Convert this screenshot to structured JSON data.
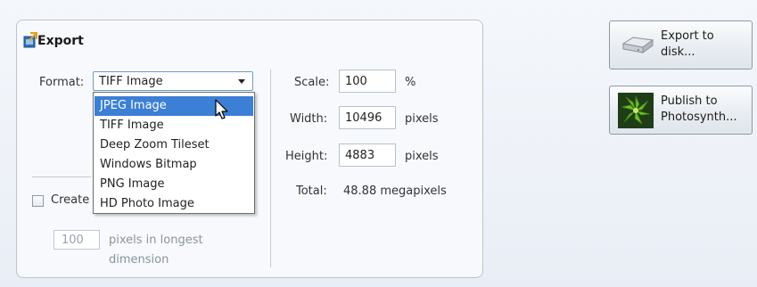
{
  "export_panel": {
    "title": "Export",
    "format_label": "Format:",
    "format_selected": "TIFF Image",
    "format_options": [
      "JPEG Image",
      "TIFF Image",
      "Deep Zoom Tileset",
      "Windows Bitmap",
      "PNG Image",
      "HD Photo Image"
    ],
    "highlighted_option": "JPEG Image",
    "create_checkbox_label": "Create",
    "create_checked": false,
    "longest_dimension_value": "100",
    "longest_dimension_label_1": "pixels in longest",
    "longest_dimension_label_2": "dimension",
    "scale_label": "Scale:",
    "scale_value": "100",
    "scale_unit": "%",
    "width_label": "Width:",
    "width_value": "10496",
    "width_unit": "pixels",
    "height_label": "Height:",
    "height_value": "4883",
    "height_unit": "pixels",
    "total_label": "Total:",
    "total_value": "48.88 megapixels"
  },
  "actions": {
    "export_disk_line1": "Export to",
    "export_disk_line2": "disk...",
    "publish_line1": "Publish to",
    "publish_line2": "Photosynth..."
  },
  "icons": {
    "export": "export-icon",
    "disk": "disk-drive-icon",
    "photosynth": "photosynth-leaf-icon",
    "cursor": "mouse-cursor-icon"
  },
  "colors": {
    "selection": "#3b7fd6",
    "panel_border": "#b9c3cf",
    "combo_border": "#6d9ad0"
  }
}
